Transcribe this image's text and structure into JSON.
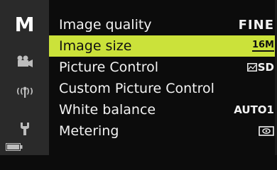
{
  "sidebar": {
    "mode_letter": "M",
    "items": [
      {
        "icon": "shooting-menu-icon"
      },
      {
        "icon": "movie-camera-icon"
      },
      {
        "icon": "wireless-network-icon"
      },
      {
        "icon": "wrench-setup-icon"
      },
      {
        "icon": "battery-icon"
      }
    ]
  },
  "menu": {
    "items": [
      {
        "label": "Image quality",
        "value": "FINE"
      },
      {
        "label": "Image size",
        "value": "16M"
      },
      {
        "label": "Picture Control",
        "value": "SD"
      },
      {
        "label": "Custom Picture Control",
        "value": ""
      },
      {
        "label": "White balance",
        "value": "AUTO1"
      },
      {
        "label": "Metering",
        "value": ""
      }
    ],
    "selected_index": 1
  },
  "colors": {
    "highlight": "#cbe23a",
    "sidebar_bg": "#2a2a2a",
    "background": "#0c0c0c",
    "text": "#f2f2f2"
  }
}
